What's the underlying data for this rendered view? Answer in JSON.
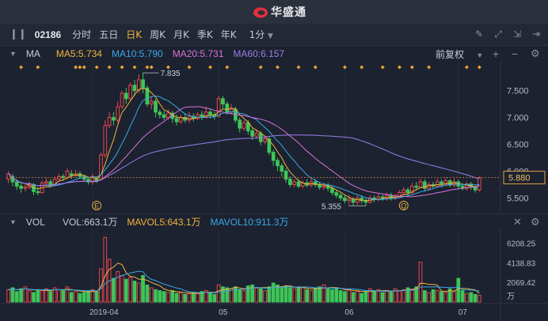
{
  "window": {
    "brand": "华盛通"
  },
  "toolbar": {
    "code": "02186",
    "periods": [
      "分时",
      "五日",
      "日K",
      "周K",
      "月K",
      "季K",
      "年K"
    ],
    "active_period": "日K",
    "minute_select": "1分"
  },
  "ma_legend": {
    "label": "MA",
    "ma5": "MA5:5.734",
    "ma10": "MA10:5.790",
    "ma20": "MA20:5.731",
    "ma60": "MA60:6.157",
    "adjust": "前复权"
  },
  "vol_legend": {
    "label": "VOL",
    "vol": "VOL:663.1万",
    "mavol5": "MAVOL5:643.1万",
    "mavol10": "MAVOL10:911.3万"
  },
  "colors": {
    "up": "#e8474e",
    "down": "#3ec559",
    "ma5": "#f0b43c",
    "ma10": "#3aa7e8",
    "ma20": "#d874d8",
    "ma60": "#9a7ee8"
  },
  "chart_data": [
    {
      "type": "candlestick",
      "ylim": [
        5.3,
        7.95
      ],
      "y_ticks": [
        "7.500",
        "7.000",
        "6.500",
        "6.000",
        "5.500"
      ],
      "y_tick_values": [
        7.5,
        7.0,
        6.5,
        6.0,
        5.5
      ],
      "current_price": "5.880",
      "current_value": 5.88,
      "high_label": "7.835",
      "low_label": "5.355",
      "x_ticks": [
        "2019-04",
        "05",
        "06",
        "07"
      ],
      "x_tick_index": [
        20,
        50,
        80,
        107
      ],
      "event_markers": [
        "E",
        "Q"
      ],
      "event_index": [
        21,
        94
      ],
      "candles": [
        [
          5.85,
          5.95,
          5.78,
          6.0
        ],
        [
          5.9,
          5.8,
          5.72,
          5.95
        ],
        [
          5.8,
          5.72,
          5.65,
          5.85
        ],
        [
          5.72,
          5.68,
          5.6,
          5.78
        ],
        [
          5.68,
          5.7,
          5.62,
          5.75
        ],
        [
          5.7,
          5.75,
          5.66,
          5.8
        ],
        [
          5.75,
          5.62,
          5.55,
          5.78
        ],
        [
          5.62,
          5.6,
          5.55,
          5.7
        ],
        [
          5.6,
          5.78,
          5.58,
          5.82
        ],
        [
          5.78,
          5.8,
          5.72,
          5.88
        ],
        [
          5.8,
          5.75,
          5.7,
          5.85
        ],
        [
          5.75,
          5.85,
          5.72,
          5.9
        ],
        [
          5.85,
          5.9,
          5.8,
          5.95
        ],
        [
          5.9,
          5.88,
          5.82,
          5.95
        ],
        [
          5.88,
          6.0,
          5.85,
          6.05
        ],
        [
          5.95,
          5.92,
          5.85,
          6.02
        ],
        [
          5.92,
          5.95,
          5.88,
          6.02
        ],
        [
          5.95,
          5.9,
          5.85,
          6.0
        ],
        [
          5.9,
          5.85,
          5.8,
          5.92
        ],
        [
          5.85,
          5.8,
          5.75,
          5.88
        ],
        [
          5.8,
          5.9,
          5.75,
          5.95
        ],
        [
          5.85,
          5.82,
          5.78,
          5.9
        ],
        [
          5.85,
          6.3,
          5.85,
          6.35
        ],
        [
          6.3,
          6.85,
          6.25,
          6.95
        ],
        [
          6.85,
          7.0,
          6.8,
          7.1
        ],
        [
          7.0,
          6.95,
          6.85,
          7.1
        ],
        [
          6.95,
          7.2,
          6.9,
          7.3
        ],
        [
          7.2,
          7.45,
          7.15,
          7.5
        ],
        [
          7.45,
          7.35,
          7.25,
          7.55
        ],
        [
          7.35,
          7.6,
          7.3,
          7.65
        ],
        [
          7.6,
          7.5,
          7.4,
          7.7
        ],
        [
          7.5,
          7.7,
          7.45,
          7.8
        ],
        [
          7.7,
          7.55,
          7.45,
          7.83
        ],
        [
          7.55,
          7.25,
          7.2,
          7.6
        ],
        [
          7.25,
          7.3,
          7.15,
          7.4
        ],
        [
          7.3,
          7.1,
          7.0,
          7.35
        ],
        [
          7.1,
          7.05,
          6.98,
          7.15
        ],
        [
          7.05,
          7.0,
          6.95,
          7.12
        ],
        [
          7.0,
          7.08,
          6.95,
          7.15
        ],
        [
          7.08,
          6.98,
          6.9,
          7.12
        ],
        [
          6.98,
          6.92,
          6.85,
          7.05
        ],
        [
          6.92,
          7.0,
          6.88,
          7.05
        ],
        [
          7.0,
          6.95,
          6.9,
          7.08
        ],
        [
          6.95,
          7.02,
          6.9,
          7.1
        ],
        [
          7.02,
          6.98,
          6.92,
          7.08
        ],
        [
          6.98,
          7.05,
          6.95,
          7.1
        ],
        [
          7.05,
          7.0,
          6.95,
          7.12
        ],
        [
          7.0,
          7.1,
          6.98,
          7.2
        ],
        [
          7.1,
          7.05,
          6.98,
          7.15
        ],
        [
          7.05,
          7.02,
          6.96,
          7.1
        ],
        [
          7.02,
          7.35,
          7.0,
          7.4
        ],
        [
          7.35,
          7.25,
          7.15,
          7.4
        ],
        [
          7.25,
          7.1,
          7.05,
          7.3
        ],
        [
          7.1,
          7.15,
          7.05,
          7.25
        ],
        [
          7.15,
          6.95,
          6.9,
          7.2
        ],
        [
          6.95,
          6.8,
          6.72,
          7.0
        ],
        [
          6.8,
          6.9,
          6.75,
          6.95
        ],
        [
          6.9,
          6.75,
          6.68,
          6.95
        ],
        [
          6.75,
          6.65,
          6.58,
          6.8
        ],
        [
          6.65,
          6.7,
          6.6,
          6.78
        ],
        [
          6.7,
          6.55,
          6.48,
          6.75
        ],
        [
          6.55,
          6.6,
          6.5,
          6.65
        ],
        [
          6.6,
          6.35,
          6.3,
          6.65
        ],
        [
          6.35,
          6.2,
          6.1,
          6.4
        ],
        [
          6.2,
          6.1,
          6.0,
          6.25
        ],
        [
          6.1,
          6.0,
          5.9,
          6.15
        ],
        [
          6.0,
          5.85,
          5.78,
          6.05
        ],
        [
          5.85,
          5.75,
          5.7,
          5.9
        ],
        [
          5.75,
          5.8,
          5.7,
          5.85
        ],
        [
          5.8,
          5.72,
          5.68,
          5.85
        ],
        [
          5.72,
          5.78,
          5.68,
          5.82
        ],
        [
          5.78,
          5.74,
          5.7,
          5.85
        ],
        [
          5.74,
          5.8,
          5.7,
          5.88
        ],
        [
          5.8,
          5.75,
          5.7,
          5.85
        ],
        [
          5.75,
          5.7,
          5.65,
          5.8
        ],
        [
          5.7,
          5.72,
          5.65,
          5.78
        ],
        [
          5.72,
          5.68,
          5.62,
          5.78
        ],
        [
          5.68,
          5.6,
          5.55,
          5.72
        ],
        [
          5.6,
          5.55,
          5.5,
          5.65
        ],
        [
          5.55,
          5.5,
          5.45,
          5.6
        ],
        [
          5.5,
          5.45,
          5.4,
          5.55
        ],
        [
          5.45,
          5.48,
          5.38,
          5.55
        ],
        [
          5.48,
          5.42,
          5.36,
          5.52
        ],
        [
          5.42,
          5.5,
          5.38,
          5.55
        ],
        [
          5.5,
          5.45,
          5.4,
          5.55
        ],
        [
          5.45,
          5.42,
          5.355,
          5.5
        ],
        [
          5.42,
          5.5,
          5.4,
          5.55
        ],
        [
          5.5,
          5.48,
          5.42,
          5.55
        ],
        [
          5.48,
          5.52,
          5.44,
          5.58
        ],
        [
          5.52,
          5.5,
          5.45,
          5.56
        ],
        [
          5.5,
          5.55,
          5.45,
          5.6
        ],
        [
          5.55,
          5.5,
          5.45,
          5.6
        ],
        [
          5.5,
          5.52,
          5.46,
          5.58
        ],
        [
          5.52,
          5.6,
          5.5,
          5.65
        ],
        [
          5.6,
          5.65,
          5.55,
          5.7
        ],
        [
          5.65,
          5.6,
          5.55,
          5.7
        ],
        [
          5.6,
          5.72,
          5.58,
          5.78
        ],
        [
          5.72,
          5.7,
          5.65,
          5.8
        ],
        [
          5.7,
          5.8,
          5.68,
          5.86
        ],
        [
          5.8,
          5.68,
          5.62,
          5.85
        ],
        [
          5.68,
          5.75,
          5.64,
          5.8
        ],
        [
          5.75,
          5.72,
          5.68,
          5.8
        ],
        [
          5.72,
          5.8,
          5.7,
          5.86
        ],
        [
          5.8,
          5.76,
          5.7,
          5.85
        ],
        [
          5.76,
          5.82,
          5.72,
          5.88
        ],
        [
          5.82,
          5.74,
          5.7,
          5.85
        ],
        [
          5.74,
          5.8,
          5.7,
          5.86
        ],
        [
          5.8,
          5.72,
          5.66,
          5.84
        ],
        [
          5.72,
          5.68,
          5.64,
          5.78
        ],
        [
          5.68,
          5.76,
          5.64,
          5.8
        ],
        [
          5.76,
          5.7,
          5.65,
          5.8
        ],
        [
          5.7,
          5.65,
          5.6,
          5.75
        ],
        [
          5.65,
          5.88,
          5.62,
          5.9
        ]
      ]
    },
    {
      "type": "bar",
      "y_ticks": [
        "6208.25",
        "4138.83",
        "2069.42"
      ],
      "y_tick_values": [
        6208.25,
        4138.83,
        2069.42
      ],
      "y_unit": "万",
      "ylim": [
        0,
        7000
      ],
      "volumes": [
        1300,
        1500,
        1100,
        1400,
        1600,
        1200,
        1000,
        1300,
        1200,
        1400,
        1100,
        1500,
        1300,
        1200,
        1600,
        1000,
        1100,
        900,
        1000,
        1200,
        1300,
        1100,
        3500,
        6800,
        4500,
        2500,
        3200,
        2800,
        2400,
        2600,
        2200,
        2000,
        2800,
        1800,
        1500,
        1300,
        1200,
        1100,
        1000,
        1200,
        900,
        1000,
        800,
        900,
        1000,
        900,
        1100,
        1200,
        1000,
        800,
        1800,
        1600,
        1500,
        1400,
        1600,
        1300,
        1200,
        1700,
        1800,
        1500,
        1400,
        1200,
        1600,
        2000,
        1800,
        1500,
        1700,
        1500,
        1400,
        1600,
        1500,
        1300,
        1200,
        1500,
        1600,
        1800,
        1400,
        1300,
        1500,
        1200,
        1100,
        1300,
        1000,
        1200,
        900,
        1100,
        1400,
        1200,
        1300,
        1000,
        1200,
        1100,
        1400,
        1200,
        1300,
        1500,
        1300,
        1600,
        4200,
        1200,
        1000,
        1300,
        1200,
        1100,
        1000,
        1400,
        1100,
        2500,
        1200,
        900,
        1000,
        800,
        700,
        600,
        700,
        800,
        650,
        660
      ]
    }
  ]
}
